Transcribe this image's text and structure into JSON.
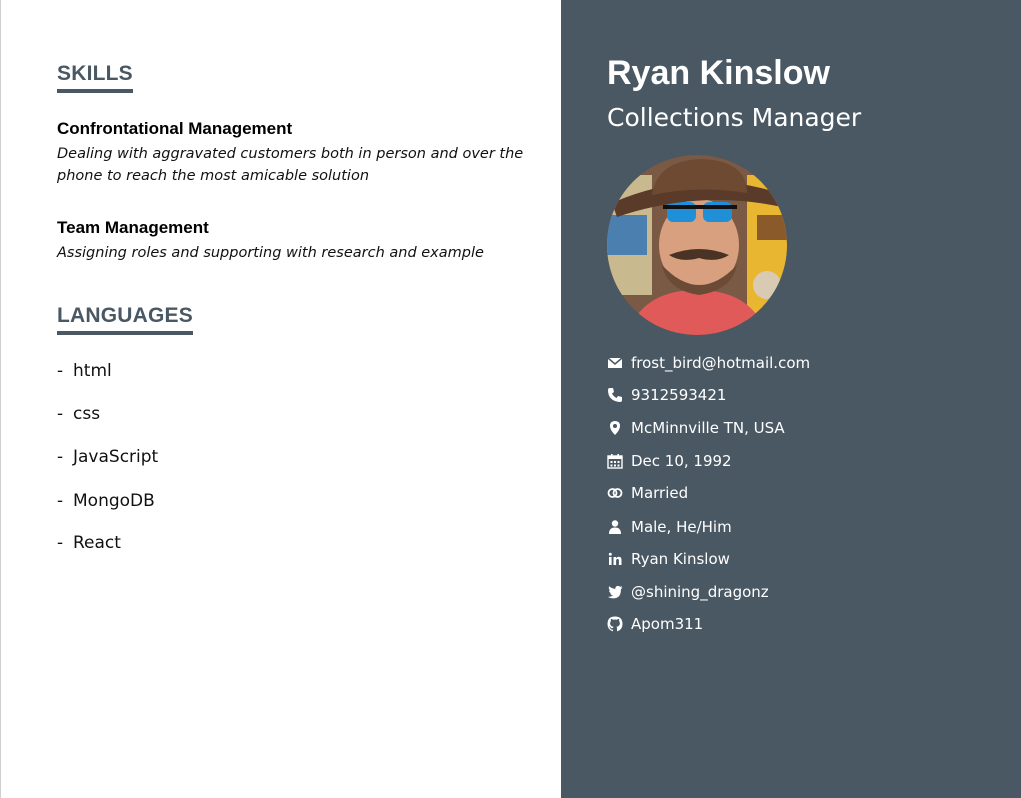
{
  "skills": {
    "heading": "SKILLS",
    "items": [
      {
        "title": "Confrontational Management",
        "description": "Dealing with aggravated customers both in person and over the phone to reach the most amicable solution"
      },
      {
        "title": "Team Management",
        "description": "Assigning roles and supporting with research and example"
      }
    ]
  },
  "languages": {
    "heading": "LANGUAGES",
    "dash": "-",
    "items": [
      "html",
      "css",
      "JavaScript",
      "MongoDB",
      "React"
    ]
  },
  "profile": {
    "name": "Ryan Kinslow",
    "role": "Collections Manager"
  },
  "contact": {
    "email": {
      "icon": "envelope-icon",
      "text": "frost_bird@hotmail.com"
    },
    "phone": {
      "icon": "phone-icon",
      "text": "9312593421"
    },
    "location": {
      "icon": "map-pin-icon",
      "text": "McMinnville TN, USA"
    },
    "birthday": {
      "icon": "calendar-icon",
      "text": "Dec 10, 1992"
    },
    "marital": {
      "icon": "rings-icon",
      "text": "Married"
    },
    "gender": {
      "icon": "person-icon",
      "text": "Male, He/Him"
    },
    "linkedin": {
      "icon": "linkedin-icon",
      "text": "Ryan Kinslow"
    },
    "twitter": {
      "icon": "twitter-icon",
      "text": "@shining_dragonz"
    },
    "github": {
      "icon": "github-icon",
      "text": "Apom311"
    }
  },
  "colors": {
    "sidebar_bg": "#4a5863",
    "accent": "#4a5863",
    "text_light": "#ffffff"
  }
}
